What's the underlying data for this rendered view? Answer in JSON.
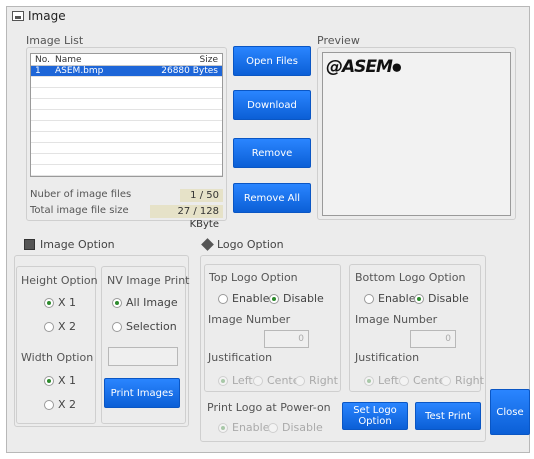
{
  "window": {
    "title": "Image"
  },
  "image_list": {
    "label": "Image List",
    "columns": [
      "No.",
      "Name",
      "Size"
    ],
    "rows": [
      {
        "no": "1",
        "name": "ASEM.bmp",
        "size": "26880 Bytes",
        "selected": true
      }
    ],
    "num_files_label": "Nuber of image files",
    "num_files_value": "1 / 50",
    "total_size_label": "Total image file size",
    "total_size_value": "27 / 128 KByte"
  },
  "buttons": {
    "open_files": "Open Files",
    "download": "Download",
    "remove": "Remove",
    "remove_all": "Remove All",
    "print_images": "Print Images",
    "set_logo_option": "Set Logo Option",
    "test_print": "Test Print",
    "close": "Close"
  },
  "preview": {
    "label": "Preview",
    "logo_text": "@ASEM"
  },
  "image_option": {
    "label": "Image Option",
    "height_label": "Height Option",
    "height_x1": "X 1",
    "height_x2": "X 2",
    "width_label": "Width Option",
    "width_x1": "X 1",
    "width_x2": "X 2",
    "nv_label": "NV Image Print",
    "nv_all": "All Image",
    "nv_selection": "Selection"
  },
  "logo_option": {
    "label": "Logo Option",
    "top": {
      "label": "Top Logo Option",
      "enable": "Enable",
      "disable": "Disable",
      "image_number_label": "Image Number",
      "image_number_value": "0",
      "justification_label": "Justification",
      "left": "Left",
      "center": "Center",
      "right": "Right"
    },
    "bottom": {
      "label": "Bottom Logo Option",
      "enable": "Enable",
      "disable": "Disable",
      "image_number_label": "Image Number",
      "image_number_value": "0",
      "justification_label": "Justification",
      "left": "Left",
      "center": "Center",
      "right": "Right"
    },
    "power_on_label": "Print Logo at Power-on",
    "power_enable": "Enable",
    "power_disable": "Disable"
  },
  "colors": {
    "button": "#1a73e8",
    "selected_row": "#1e66d8",
    "value_bg": "#e6e2c8"
  }
}
